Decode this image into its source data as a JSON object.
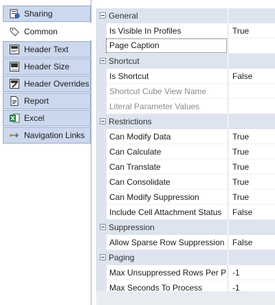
{
  "nav": {
    "items": [
      {
        "label": "Sharing",
        "icon": "sharing-icon"
      },
      {
        "label": "Common",
        "icon": "tag-icon"
      },
      {
        "label": "Header Text",
        "icon": "header-text-icon"
      },
      {
        "label": "Header Size",
        "icon": "header-size-icon"
      },
      {
        "label": "Header Overrides",
        "icon": "header-overrides-icon"
      },
      {
        "label": "Report",
        "icon": "report-icon"
      },
      {
        "label": "Excel",
        "icon": "excel-icon"
      },
      {
        "label": "Navigation Links",
        "icon": "navigation-links-icon"
      }
    ],
    "active": "Common"
  },
  "grid": {
    "categories": [
      {
        "label": "General",
        "props": [
          {
            "name": "Is Visible In Profiles",
            "value": "True",
            "disabled": false
          },
          {
            "name": "Page Caption",
            "value": "",
            "disabled": false,
            "focused": true
          }
        ]
      },
      {
        "label": "Shortcut",
        "props": [
          {
            "name": "Is Shortcut",
            "value": "False",
            "disabled": false
          },
          {
            "name": "Shortcut Cube View Name",
            "value": "",
            "disabled": true
          },
          {
            "name": "Literal Parameter Values",
            "value": "",
            "disabled": true
          }
        ]
      },
      {
        "label": "Restrictions",
        "props": [
          {
            "name": "Can Modify Data",
            "value": "True",
            "disabled": false
          },
          {
            "name": "Can Calculate",
            "value": "True",
            "disabled": false
          },
          {
            "name": "Can Translate",
            "value": "True",
            "disabled": false
          },
          {
            "name": "Can Consolidate",
            "value": "True",
            "disabled": false
          },
          {
            "name": "Can Modify Suppression",
            "value": "True",
            "disabled": false
          },
          {
            "name": "Include Cell Attachment Status",
            "value": "False",
            "disabled": false
          }
        ]
      },
      {
        "label": "Suppression",
        "props": [
          {
            "name": "Allow Sparse Row Suppression",
            "value": "False",
            "disabled": false
          }
        ]
      },
      {
        "label": "Paging",
        "props": [
          {
            "name": "Max Unsuppressed Rows Per Pag",
            "value": "-1",
            "disabled": false
          },
          {
            "name": "Max Seconds To Process",
            "value": "-1",
            "disabled": false
          }
        ]
      }
    ]
  },
  "colors": {
    "nav_tab": "#ccd8ee",
    "nav_border": "#9aaccc",
    "category_band": "#dde4ef",
    "disabled_text": "#8a8a8a"
  }
}
